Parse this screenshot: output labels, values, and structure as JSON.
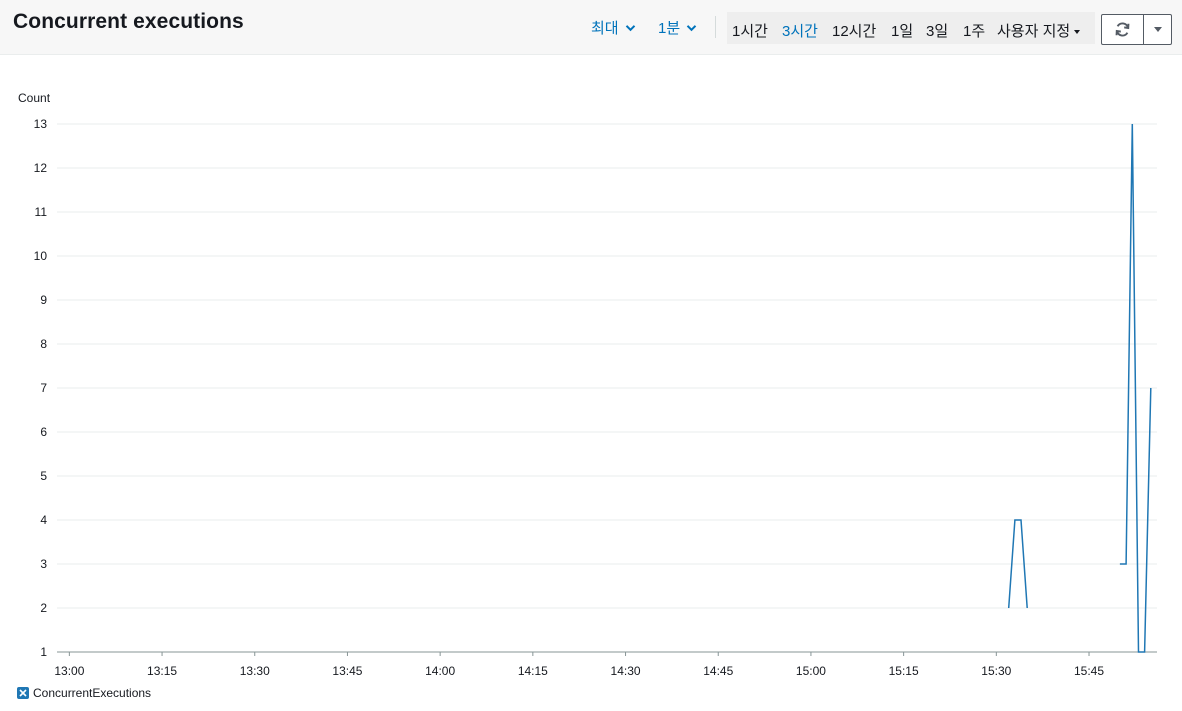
{
  "header": {
    "title": "Concurrent executions",
    "statistic": "최대",
    "period": "1분",
    "time_ranges": [
      {
        "label": "1시간",
        "active": false
      },
      {
        "label": "3시간",
        "active": true
      },
      {
        "label": "12시간",
        "active": false
      },
      {
        "label": "1일",
        "active": false
      },
      {
        "label": "3일",
        "active": false
      },
      {
        "label": "1주",
        "active": false
      }
    ],
    "custom_label": "사용자 지정"
  },
  "colors": {
    "series": "#1f77b4",
    "accent": "#0073bb",
    "grid": "#eaeded"
  },
  "chart_data": {
    "type": "line",
    "title": "Concurrent executions",
    "ylabel": "Count",
    "xlabel": "",
    "ylim": [
      1,
      13
    ],
    "y_ticks": [
      "1",
      "2",
      "3",
      "4",
      "5",
      "6",
      "7",
      "8",
      "9",
      "10",
      "11",
      "12",
      "13"
    ],
    "x_ticks": [
      "13:00",
      "13:15",
      "13:30",
      "13:45",
      "14:00",
      "14:15",
      "14:30",
      "14:45",
      "15:00",
      "15:15",
      "15:30",
      "15:45"
    ],
    "x_range": [
      "12:58",
      "15:56"
    ],
    "grid": true,
    "legend_position": "bottom-left",
    "series": [
      {
        "name": "ConcurrentExecutions",
        "segments": [
          [
            [
              "15:32",
              2
            ],
            [
              "15:33",
              4
            ],
            [
              "15:34",
              4
            ],
            [
              "15:35",
              2
            ]
          ],
          [
            [
              "15:50",
              3
            ],
            [
              "15:51",
              3
            ],
            [
              "15:52",
              13
            ],
            [
              "15:53",
              1
            ],
            [
              "15:54",
              1
            ],
            [
              "15:55",
              7
            ]
          ]
        ]
      }
    ]
  }
}
